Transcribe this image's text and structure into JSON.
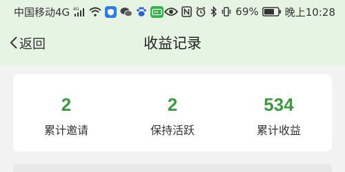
{
  "status_bar": {
    "carrier": "中国移动4G",
    "network_badge": "4G",
    "battery": "69%",
    "time": "晚上10:28",
    "icons": [
      "signal-icon",
      "wifi-icon",
      "shield-app-icon",
      "wechat-icon",
      "baidu-paw-icon",
      "iqiyi-icon",
      "eye-icon",
      "nfc-icon",
      "alarm-icon",
      "bluetooth-icon",
      "vibrate-icon",
      "battery-icon"
    ],
    "app_icon_colors": {
      "shield": "#2b7de9",
      "iqiyi": "#2fb34a",
      "baidu": "#2b5fd9"
    }
  },
  "nav": {
    "back_label": "返回",
    "title": "收益记录"
  },
  "stats": [
    {
      "value": "2",
      "label": "累计邀请"
    },
    {
      "value": "2",
      "label": "保持活跃"
    },
    {
      "value": "534",
      "label": "累计收益"
    }
  ],
  "colors": {
    "accent": "#3a9a3e",
    "header_bg": "#e6f4e3",
    "page_bg": "#f2f2f2"
  }
}
